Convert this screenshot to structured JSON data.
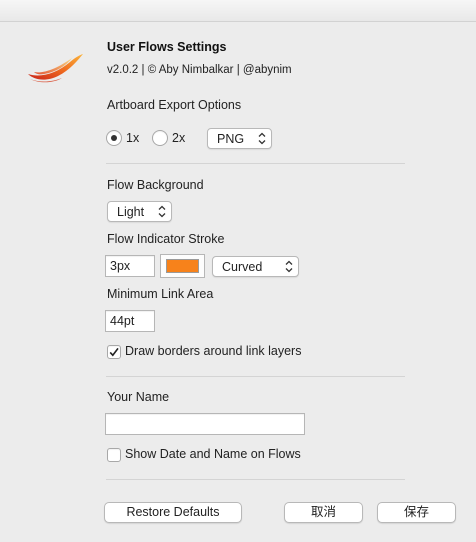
{
  "header": {
    "title": "User Flows Settings",
    "version_line": "v2.0.2 | © Aby Nimbalkar | @abynim"
  },
  "export": {
    "heading": "Artboard Export Options",
    "scale_1x_label": "1x",
    "scale_2x_label": "2x",
    "scale_selected": "1x",
    "format_value": "PNG"
  },
  "flow": {
    "background_heading": "Flow Background",
    "background_value": "Light",
    "stroke_heading": "Flow Indicator Stroke",
    "stroke_width_value": "3px",
    "stroke_color": "#f7821b",
    "stroke_style_value": "Curved",
    "min_link_heading": "Minimum Link Area",
    "min_link_value": "44pt",
    "draw_borders_label": "Draw borders around link layers",
    "draw_borders_checked": true
  },
  "name": {
    "heading": "Your Name",
    "value": "",
    "show_date_label": "Show Date and Name on Flows",
    "show_date_checked": false
  },
  "footer": {
    "restore_label": "Restore Defaults",
    "cancel_label": "取消",
    "save_label": "保存"
  },
  "icons": {
    "logo": "brush-stroke-logo",
    "popup": "up-down-chevron-icon",
    "check": "checkmark-icon"
  }
}
